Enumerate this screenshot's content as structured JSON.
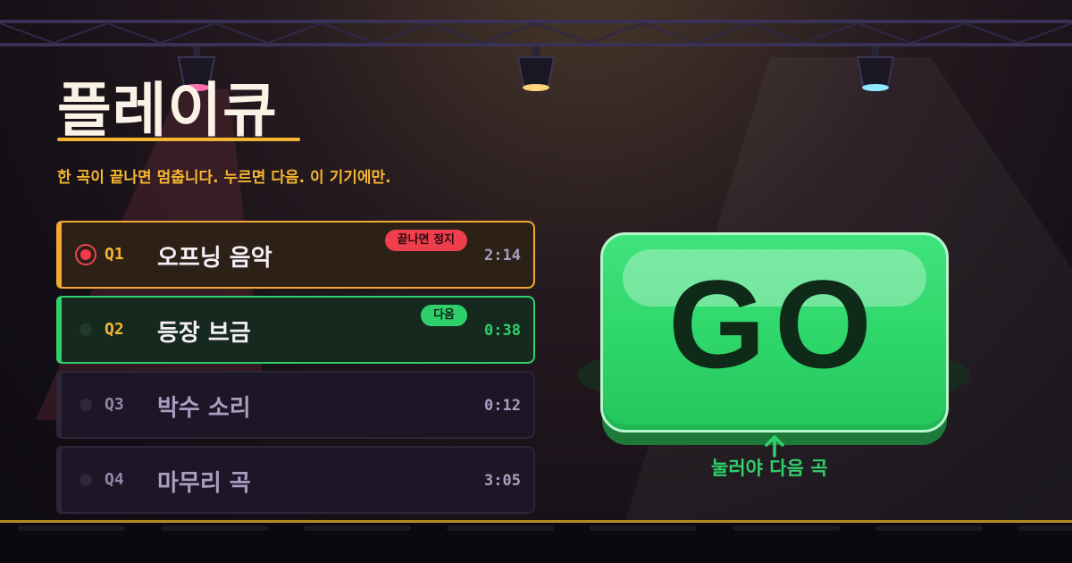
{
  "title": "플레이큐",
  "subtitle": "한 곡이 끝나면 멈춥니다. 누르면 다음. 이 기기에만.",
  "queue": [
    {
      "num": "Q1",
      "song": "오프닝 음악",
      "duration": "2:14",
      "status": "playing",
      "badge": "끝나면 정지"
    },
    {
      "num": "Q2",
      "song": "등장 브금",
      "duration": "0:38",
      "status": "next",
      "badge": "다음"
    },
    {
      "num": "Q3",
      "song": "박수 소리",
      "duration": "0:12",
      "status": "queued"
    },
    {
      "num": "Q4",
      "song": "마무리 곡",
      "duration": "3:05",
      "status": "queued"
    }
  ],
  "go_button": {
    "label": "GO",
    "hint": "눌러야 다음 곡"
  },
  "icons": {
    "playing": "record-dot-icon",
    "hint": "arrow-up-icon"
  },
  "colors": {
    "accent": "#f5b530",
    "playing": "#f2aa33",
    "stop_badge": "#ef3e4c",
    "next": "#2fd06b",
    "background": "#140f16",
    "spot_pink": "#ff6fae",
    "spot_amber": "#ffd37a",
    "spot_cyan": "#8fe8ff"
  }
}
